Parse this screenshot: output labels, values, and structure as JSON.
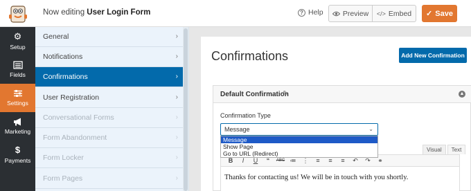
{
  "header": {
    "editing_prefix": "Now editing",
    "form_name": "User Login Form",
    "help_label": "Help",
    "preview_label": "Preview",
    "embed_label": "Embed",
    "save_label": "Save",
    "accent_color": "#e27730"
  },
  "leftnav": {
    "items": [
      {
        "label": "Setup",
        "icon": "gear-icon"
      },
      {
        "label": "Fields",
        "icon": "fields-icon"
      },
      {
        "label": "Settings",
        "icon": "sliders-icon",
        "active": true
      },
      {
        "label": "Marketing",
        "icon": "megaphone-icon"
      },
      {
        "label": "Payments",
        "icon": "dollar-icon"
      }
    ]
  },
  "settings": {
    "items": [
      {
        "label": "General"
      },
      {
        "label": "Notifications"
      },
      {
        "label": "Confirmations",
        "active": true
      },
      {
        "label": "User Registration"
      },
      {
        "label": "Conversational Forms",
        "disabled": true
      },
      {
        "label": "Form Abandonment",
        "disabled": true
      },
      {
        "label": "Form Locker",
        "disabled": true
      },
      {
        "label": "Form Pages",
        "disabled": true
      }
    ]
  },
  "main": {
    "title": "Confirmations",
    "add_button": "Add New Confirmation",
    "panel_title": "Default Confirmation",
    "type_label": "Confirmation Type",
    "select_value": "Message",
    "options": [
      "Message",
      "Show Page",
      "Go to URL (Redirect)"
    ],
    "tabs": [
      "Visual",
      "Text"
    ],
    "editor_text": "Thanks for contacting us! We will be in touch with you shortly.",
    "primary_color": "#036aab"
  }
}
